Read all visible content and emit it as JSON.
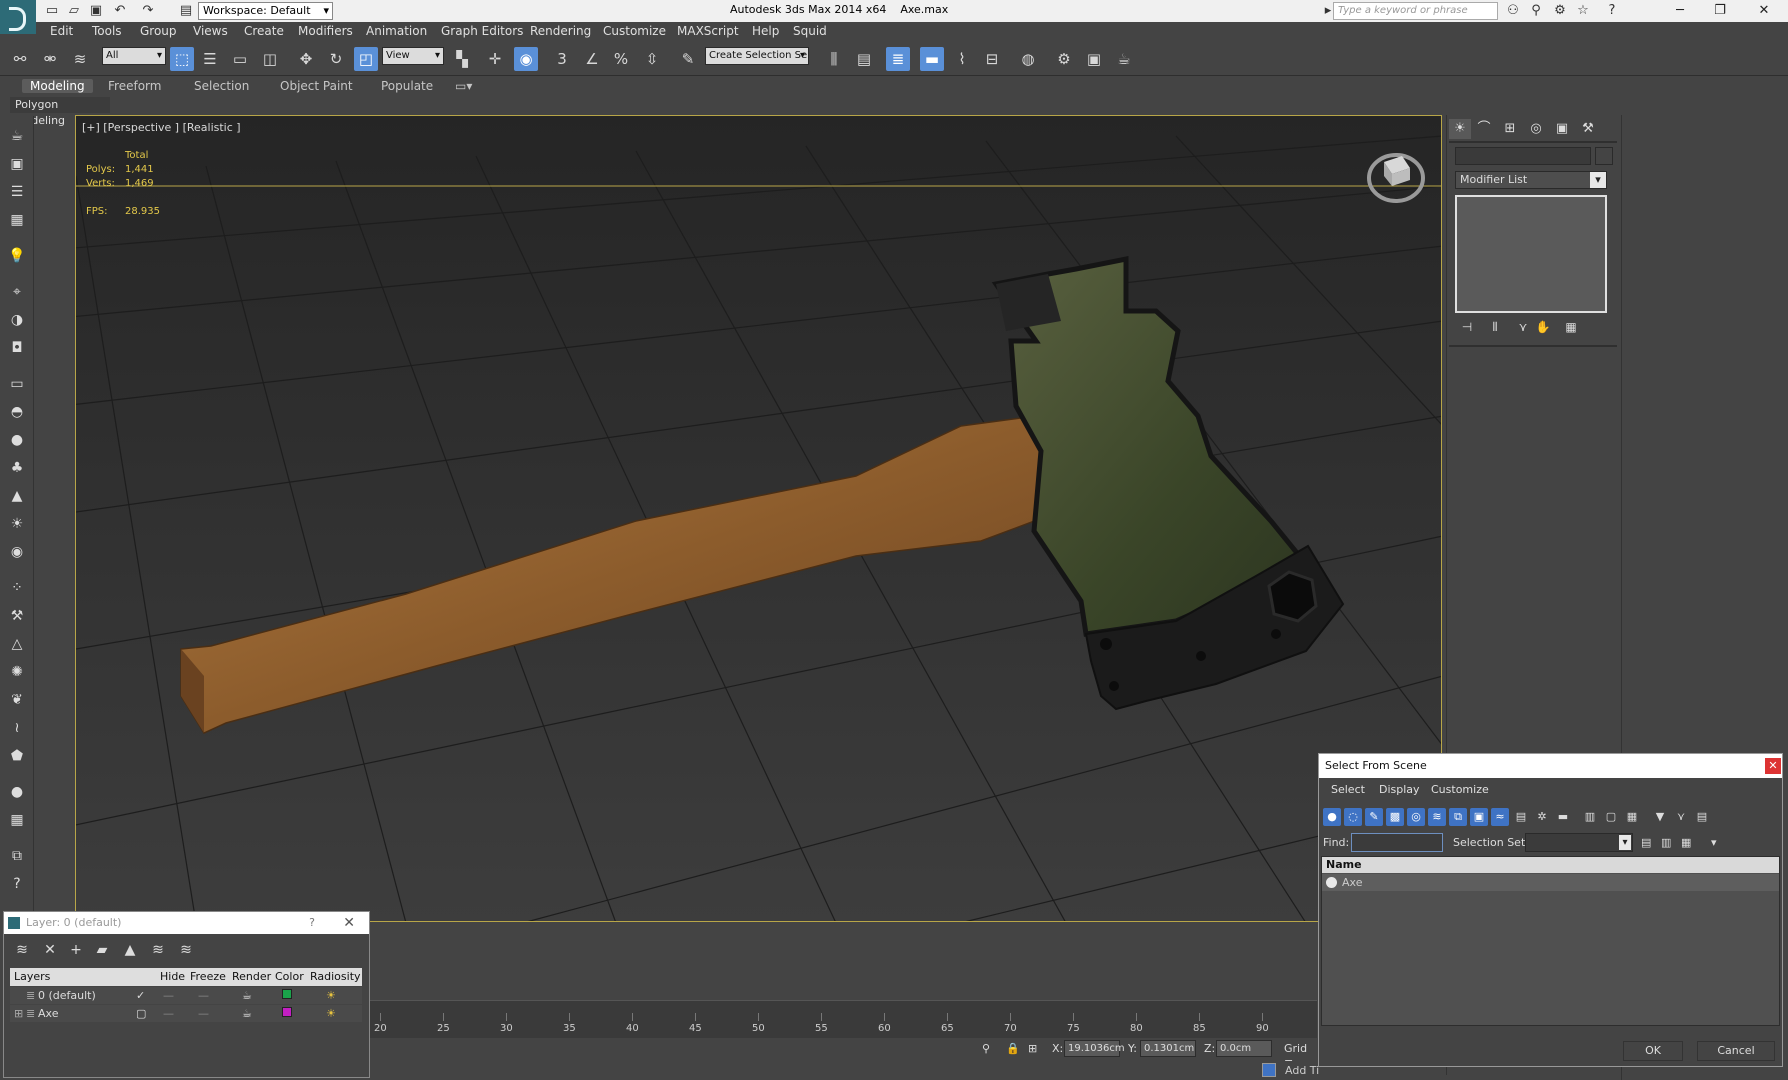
{
  "titlebar": {
    "workspace": "Workspace: Default",
    "app_title": "Autodesk 3ds Max  2014 x64",
    "file_name": "Axe.max",
    "search_placeholder": "Type a keyword or phrase"
  },
  "menu": [
    "Edit",
    "Tools",
    "Group",
    "Views",
    "Create",
    "Modifiers",
    "Animation",
    "Graph Editors",
    "Rendering",
    "Customize",
    "MAXScript",
    "Help",
    "Squid"
  ],
  "toolbar": {
    "filter_value": "All",
    "ref_coord_value": "View",
    "selection_set_value": "Create Selection Se",
    "snap_3": "3",
    "angle_snap": "%"
  },
  "ribbon": {
    "tabs": [
      "Modeling",
      "Freeform",
      "Selection",
      "Object Paint",
      "Populate"
    ],
    "active_tab": "Modeling",
    "panel_label": "Polygon Modeling"
  },
  "viewport": {
    "label": "[+] [Perspective ] [Realistic ]",
    "stats": {
      "total_label": "Total",
      "polys_label": "Polys:",
      "polys_value": "1,441",
      "verts_label": "Verts:",
      "verts_value": "1,469",
      "fps_label": "FPS:",
      "fps_value": "28.935"
    },
    "object_colors": {
      "handle": "#8a5a2b",
      "blade": "#3c4a2a",
      "edge": "#1b1b1b"
    }
  },
  "timeline": {
    "ticks": [
      "20",
      "25",
      "30",
      "35",
      "40",
      "45",
      "50",
      "55",
      "60",
      "65",
      "70",
      "75",
      "80",
      "85",
      "90"
    ]
  },
  "status": {
    "x_label": "X:",
    "x_value": "19.1036cm",
    "y_label": "Y:",
    "y_value": "0.1301cm",
    "z_label": "Z:",
    "z_value": "0.0cm",
    "grid_label": "Grid =",
    "add_time": "Add Ti"
  },
  "command_panel": {
    "modifier_list": "Modifier List"
  },
  "layer_dialog": {
    "title": "Layer: 0 (default)",
    "help": "?",
    "columns": [
      "Layers",
      "Hide",
      "Freeze",
      "Render",
      "Color",
      "Radiosity"
    ],
    "rows": [
      {
        "name": "0 (default)",
        "color": "#1aa34a"
      },
      {
        "name": "Axe",
        "color": "#c21fc2"
      }
    ]
  },
  "select_dialog": {
    "title": "Select From Scene",
    "menu": [
      "Select",
      "Display",
      "Customize"
    ],
    "find_label": "Find:",
    "find_value": "",
    "selection_set_label": "Selection Set:",
    "column_name": "Name",
    "items": [
      "Axe"
    ],
    "ok": "OK",
    "cancel": "Cancel"
  }
}
